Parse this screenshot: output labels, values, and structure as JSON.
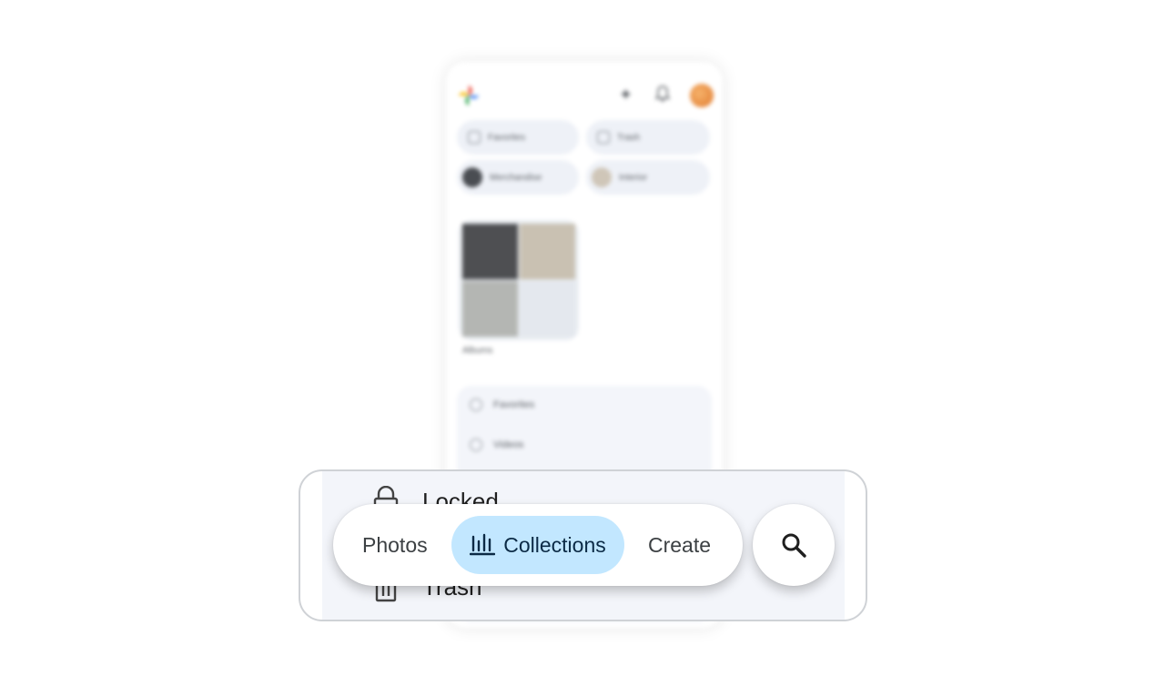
{
  "background_app": {
    "chips": [
      {
        "label": "Favorites",
        "icon": "star-icon"
      },
      {
        "label": "Trash",
        "icon": "trash-icon"
      },
      {
        "label": "Merchandise",
        "icon": "album-thumbnail"
      },
      {
        "label": "Interior",
        "icon": "album-thumbnail"
      }
    ],
    "albums_label": "Albums",
    "list_items": [
      {
        "label": "Favorites",
        "icon": "star-icon"
      },
      {
        "label": "Videos",
        "icon": "play-icon"
      }
    ]
  },
  "magnified": {
    "behind_rows": [
      {
        "label": "Locked",
        "icon": "lock-icon"
      },
      {
        "label": "Trash",
        "icon": "trash-icon"
      }
    ],
    "nav": {
      "tabs": [
        {
          "label": "Photos",
          "selected": false
        },
        {
          "label": "Collections",
          "selected": true,
          "icon": "collections-icon"
        },
        {
          "label": "Create",
          "selected": false
        }
      ],
      "search_icon": "search-icon"
    }
  },
  "colors": {
    "selected_tab_bg": "#c2e7ff",
    "selected_tab_text": "#0b2a45",
    "avatar": "#e07a2e"
  }
}
